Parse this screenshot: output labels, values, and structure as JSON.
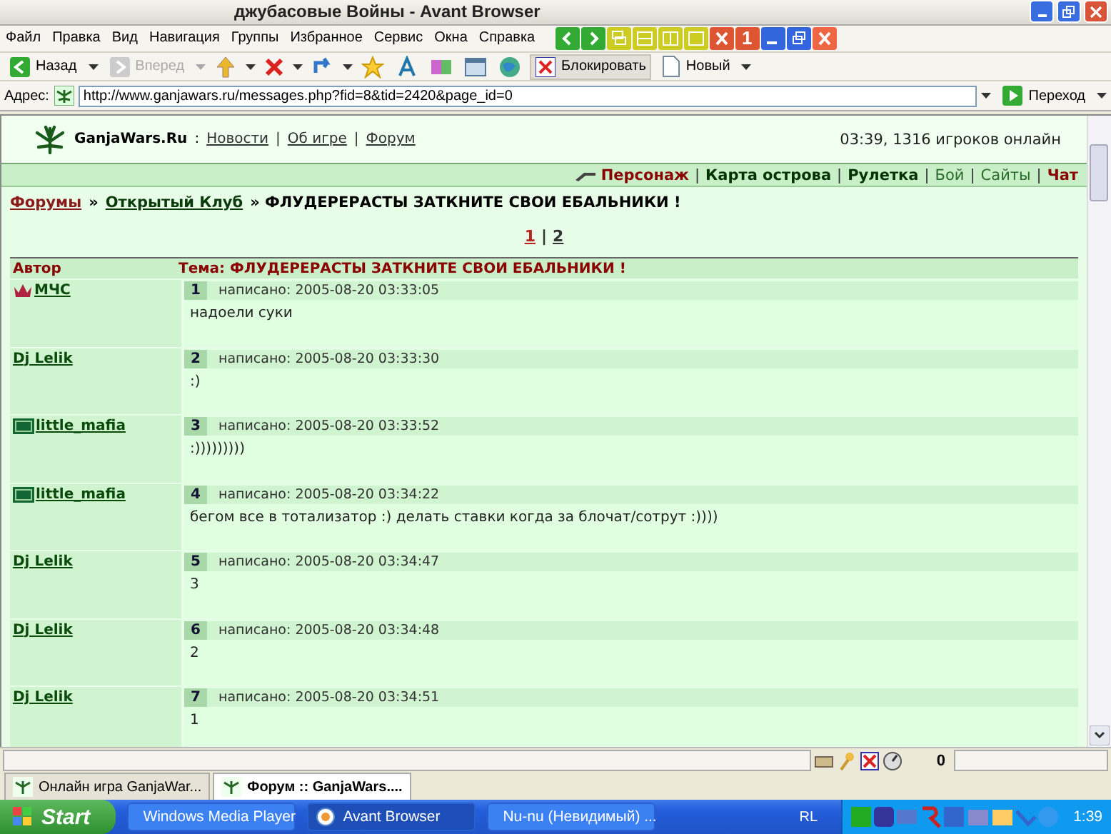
{
  "window": {
    "title": "джубасовые Войны - Avant Browser"
  },
  "menu": [
    "Файл",
    "Правка",
    "Вид",
    "Навигация",
    "Группы",
    "Избранное",
    "Сервис",
    "Окна",
    "Справка"
  ],
  "window_buttons": [
    {
      "kind": "left"
    },
    {
      "kind": "right"
    },
    {
      "kind": "cascade"
    },
    {
      "kind": "hsplit"
    },
    {
      "kind": "vsplit"
    },
    {
      "kind": "square"
    },
    {
      "kind": "closeall"
    },
    {
      "kind": "number",
      "label": "1"
    },
    {
      "kind": "minimize"
    },
    {
      "kind": "restore"
    },
    {
      "kind": "close"
    }
  ],
  "toolbar": {
    "back": "Назад",
    "forward": "Вперед",
    "forward_disabled": true,
    "block": "Блокировать",
    "new": "Новый"
  },
  "address": {
    "label": "Адрес:",
    "value": "http://www.ganjawars.ru/messages.php?fid=8&tid=2420&page_id=0",
    "go": "Переход"
  },
  "site": {
    "name": "GanjaWars.Ru",
    "sep": ":",
    "links": [
      {
        "label": "Новости"
      },
      {
        "label": "Об игре",
        "sep": "|"
      },
      {
        "label": "Форум",
        "sep": "|"
      }
    ],
    "online": "03:39, 1316 игроков онлайн"
  },
  "nav": [
    {
      "label": "Персонаж",
      "kind": "highlight"
    },
    {
      "label": "Карта острова",
      "kind": "bold",
      "sep": "|"
    },
    {
      "label": "Рулетка",
      "kind": "bold",
      "sep": "|"
    },
    {
      "label": "Бой",
      "kind": "plain",
      "sep": "|"
    },
    {
      "label": "Сайты",
      "kind": "plain",
      "sep": "|"
    },
    {
      "label": "Чат",
      "kind": "highlight",
      "sep": "|"
    }
  ],
  "breadcrumb": {
    "forums": "Форумы",
    "club": "Открытый Клуб",
    "topic": "» ФЛУДЕРЕРАСТЫ ЗАТКНИТЕ СВОИ ЕБАЛЬНИКИ !",
    "sep": "»"
  },
  "pages": [
    {
      "label": "1",
      "selected": true
    },
    {
      "label": "2",
      "selected": false,
      "sep": "|"
    }
  ],
  "table": {
    "columns": [
      "Автор",
      "Тема: ФЛУДЕРЕРАСТЫ ЗАТКНИТЕ СВОИ ЕБАЛЬНИКИ !"
    ],
    "rows": [
      {
        "author": "МЧС",
        "kind": "crown",
        "num": "1",
        "posted": "написано: 2005-08-20 03:33:05",
        "text": "надоели суки"
      },
      {
        "author": "Dj Lelik",
        "num": "2",
        "posted": "написано: 2005-08-20 03:33:30",
        "text": ":)"
      },
      {
        "author": "little_mafia",
        "kind": "clan",
        "num": "3",
        "posted": "написано: 2005-08-20 03:33:52",
        "text": ":)))))))))"
      },
      {
        "author": "little_mafia",
        "kind": "clan",
        "num": "4",
        "posted": "написано: 2005-08-20 03:34:22",
        "text": "бегом все в тотализатор :) делать ставки когда за блочат/сотрут :))))"
      },
      {
        "author": "Dj Lelik",
        "num": "5",
        "posted": "написано: 2005-08-20 03:34:47",
        "text": "3"
      },
      {
        "author": "Dj Lelik",
        "num": "6",
        "posted": "написано: 2005-08-20 03:34:48",
        "text": "2"
      },
      {
        "author": "Dj Lelik",
        "num": "7",
        "posted": "написано: 2005-08-20 03:34:51",
        "text": "1"
      }
    ]
  },
  "status_bar": {
    "counter": "0"
  },
  "tabs": [
    {
      "label": "Онлайн игра GanjaWar...",
      "selected": false
    },
    {
      "label": "Форум :: GanjaWars....",
      "selected": true
    }
  ],
  "taskbar": {
    "start": "Start",
    "items": [
      {
        "label": "Windows Media Player",
        "selected": false
      },
      {
        "label": "Avant Browser",
        "selected": true
      },
      {
        "label": "Nu-nu (Невидимый) ...",
        "selected": false
      }
    ],
    "lang": "RL",
    "clock": "1:39"
  }
}
